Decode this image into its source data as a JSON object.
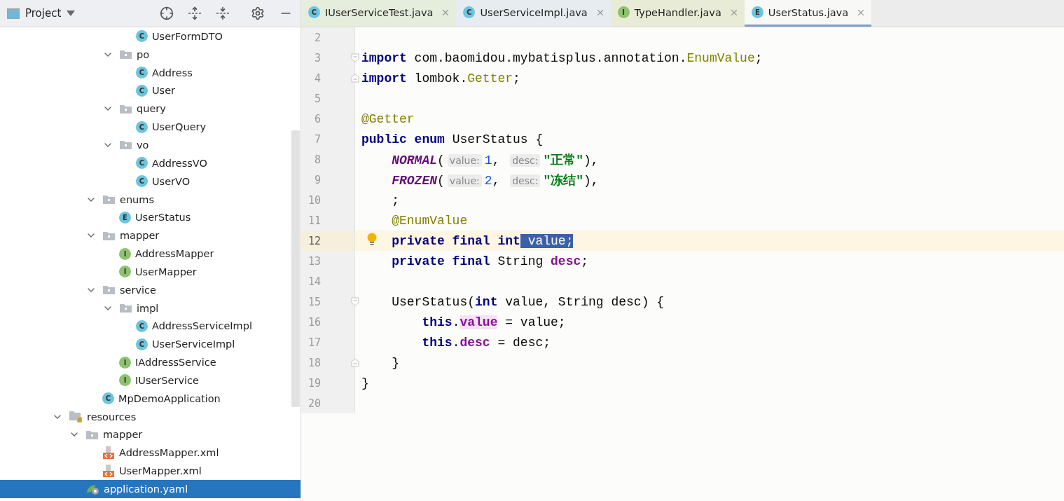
{
  "sidebar": {
    "title": "Project",
    "tree": [
      {
        "kind": "offscreen",
        "children": [
          {
            "kind": "offscreen",
            "children": [
              {
                "kind": "offscreen",
                "children": [
                  {
                    "kind": "offscreen",
                    "children": [
                      {
                        "label": "UserFormDTO",
                        "kind": "class",
                        "badge": "C",
                        "selected": false
                      }
                    ]
                  },
                  {
                    "label": "po",
                    "kind": "folder",
                    "expanded": true,
                    "selected": false,
                    "children": [
                      {
                        "label": "Address",
                        "kind": "class",
                        "badge": "C",
                        "selected": false
                      },
                      {
                        "label": "User",
                        "kind": "class",
                        "badge": "C",
                        "selected": false
                      }
                    ]
                  },
                  {
                    "label": "query",
                    "kind": "folder",
                    "expanded": true,
                    "selected": false,
                    "children": [
                      {
                        "label": "UserQuery",
                        "kind": "class",
                        "badge": "C",
                        "selected": false
                      }
                    ]
                  },
                  {
                    "label": "vo",
                    "kind": "folder",
                    "expanded": true,
                    "selected": false,
                    "children": [
                      {
                        "label": "AddressVO",
                        "kind": "class",
                        "badge": "C",
                        "selected": false
                      },
                      {
                        "label": "UserVO",
                        "kind": "class",
                        "badge": "C",
                        "selected": false
                      }
                    ]
                  }
                ]
              },
              {
                "label": "enums",
                "kind": "folder",
                "expanded": true,
                "selected": false,
                "children": [
                  {
                    "label": "UserStatus",
                    "kind": "enum",
                    "badge": "E",
                    "selected": false
                  }
                ]
              },
              {
                "label": "mapper",
                "kind": "folder",
                "expanded": true,
                "selected": false,
                "children": [
                  {
                    "label": "AddressMapper",
                    "kind": "interface",
                    "badge": "I",
                    "selected": false
                  },
                  {
                    "label": "UserMapper",
                    "kind": "interface",
                    "badge": "I",
                    "selected": false
                  }
                ]
              },
              {
                "label": "service",
                "kind": "folder",
                "expanded": true,
                "selected": false,
                "children": [
                  {
                    "label": "impl",
                    "kind": "folder",
                    "expanded": true,
                    "selected": false,
                    "children": [
                      {
                        "label": "AddressServiceImpl",
                        "kind": "class",
                        "badge": "C",
                        "selected": false
                      },
                      {
                        "label": "UserServiceImpl",
                        "kind": "class",
                        "badge": "C",
                        "selected": false
                      }
                    ]
                  },
                  {
                    "label": "IAddressService",
                    "kind": "interface",
                    "badge": "I",
                    "selected": false
                  },
                  {
                    "label": "IUserService",
                    "kind": "interface",
                    "badge": "I",
                    "selected": false
                  }
                ]
              },
              {
                "label": "MpDemoApplication",
                "kind": "app",
                "badge": "C",
                "selected": false
              }
            ]
          }
        ]
      },
      {
        "label": "resources",
        "kind": "resources",
        "expanded": true,
        "selected": false,
        "children": [
          {
            "label": "mapper",
            "kind": "folder",
            "expanded": true,
            "selected": false,
            "children": [
              {
                "label": "AddressMapper.xml",
                "kind": "xml",
                "selected": false
              },
              {
                "label": "UserMapper.xml",
                "kind": "xml",
                "selected": false
              }
            ]
          },
          {
            "label": "application.yaml",
            "kind": "yaml",
            "selected": true
          }
        ]
      }
    ]
  },
  "tabs": [
    {
      "label": "IUserServiceTest.java",
      "badge": "C",
      "kind": "test",
      "color": "#e5eddd",
      "selected": false
    },
    {
      "label": "UserServiceImpl.java",
      "badge": "C",
      "kind": "class",
      "color": "#e6ecef",
      "selected": false
    },
    {
      "label": "TypeHandler.java",
      "badge": "I",
      "kind": "interface",
      "color": "#e8ecd6",
      "selected": false
    },
    {
      "label": "UserStatus.java",
      "badge": "E",
      "kind": "enum",
      "color": "#f8f8f6",
      "selected": true
    }
  ],
  "editor": {
    "lines": [
      {
        "number": "2",
        "current": false
      },
      {
        "number": "3",
        "current": false,
        "fold_open": true,
        "tokens": [
          {
            "kind": "kw",
            "text": "import"
          },
          {
            "kind": "plain",
            "text": " com.baomidou.mybatisplus.annotation."
          },
          {
            "kind": "type",
            "text": "EnumValue"
          },
          {
            "kind": "plain",
            "text": ";"
          }
        ]
      },
      {
        "number": "4",
        "current": false,
        "fold_close": true,
        "tokens": [
          {
            "kind": "kw",
            "text": "import"
          },
          {
            "kind": "plain",
            "text": " lombok."
          },
          {
            "kind": "type",
            "text": "Getter"
          },
          {
            "kind": "plain",
            "text": ";"
          }
        ]
      },
      {
        "number": "5",
        "current": false
      },
      {
        "number": "6",
        "current": false,
        "tokens": [
          {
            "kind": "ann",
            "text": "@Getter"
          }
        ]
      },
      {
        "number": "7",
        "current": false,
        "tokens": [
          {
            "kind": "kw",
            "text": "public enum"
          },
          {
            "kind": "plain",
            "text": " UserStatus {"
          }
        ]
      },
      {
        "number": "8",
        "current": false,
        "tokens": [
          {
            "kind": "const",
            "text": "    NORMAL"
          },
          {
            "kind": "plain",
            "text": "("
          },
          {
            "kind": "hint",
            "text": "value:"
          },
          {
            "kind": "num",
            "text": "1"
          },
          {
            "kind": "plain",
            "text": ", "
          },
          {
            "kind": "hint",
            "text": "desc:"
          },
          {
            "kind": "str",
            "text": "\"正常\""
          },
          {
            "kind": "plain",
            "text": "),"
          }
        ]
      },
      {
        "number": "9",
        "current": false,
        "tokens": [
          {
            "kind": "const",
            "text": "    FROZEN"
          },
          {
            "kind": "plain",
            "text": "("
          },
          {
            "kind": "hint",
            "text": "value:"
          },
          {
            "kind": "num",
            "text": "2"
          },
          {
            "kind": "plain",
            "text": ", "
          },
          {
            "kind": "hint",
            "text": "desc:"
          },
          {
            "kind": "str",
            "text": "\"冻结\""
          },
          {
            "kind": "plain",
            "text": "),"
          }
        ]
      },
      {
        "number": "10",
        "current": false,
        "tokens": [
          {
            "kind": "plain",
            "text": "    ;"
          }
        ]
      },
      {
        "number": "11",
        "current": false,
        "tokens": [
          {
            "kind": "ann",
            "text": "    @EnumValue"
          }
        ]
      },
      {
        "number": "12",
        "current": true,
        "bulb": true,
        "tokens": [
          {
            "kind": "kw",
            "text": "    private final int"
          },
          {
            "kind": "sel",
            "text": " value;"
          }
        ]
      },
      {
        "number": "13",
        "current": false,
        "tokens": [
          {
            "kind": "kw",
            "text": "    private final"
          },
          {
            "kind": "plain",
            "text": " String "
          },
          {
            "kind": "field",
            "text": "desc"
          },
          {
            "kind": "plain",
            "text": ";"
          }
        ]
      },
      {
        "number": "14",
        "current": false
      },
      {
        "number": "15",
        "current": false,
        "fold_open": true,
        "tokens": [
          {
            "kind": "plain",
            "text": "    UserStatus("
          },
          {
            "kind": "kw",
            "text": "int"
          },
          {
            "kind": "plain",
            "text": " value, String desc) {"
          }
        ]
      },
      {
        "number": "16",
        "current": false,
        "tokens": [
          {
            "kind": "kw",
            "text": "        this"
          },
          {
            "kind": "plain",
            "text": "."
          },
          {
            "kind": "usage",
            "text": "value"
          },
          {
            "kind": "plain",
            "text": " = value;"
          }
        ]
      },
      {
        "number": "17",
        "current": false,
        "tokens": [
          {
            "kind": "kw",
            "text": "        this"
          },
          {
            "kind": "plain",
            "text": "."
          },
          {
            "kind": "field",
            "text": "desc"
          },
          {
            "kind": "plain",
            "text": " = desc;"
          }
        ]
      },
      {
        "number": "18",
        "current": false,
        "fold_close": true,
        "tokens": [
          {
            "kind": "plain",
            "text": "    }"
          }
        ]
      },
      {
        "number": "19",
        "current": false,
        "tokens": [
          {
            "kind": "plain",
            "text": "}"
          }
        ]
      },
      {
        "number": "20",
        "current": false
      }
    ]
  }
}
